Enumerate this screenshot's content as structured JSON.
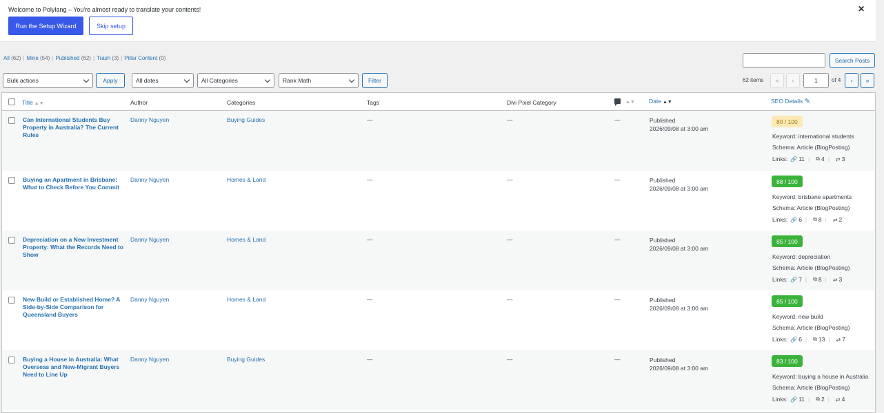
{
  "notice": {
    "message": "Welcome to Polylang – You're almost ready to translate your contents!",
    "wizard_label": "Run the Setup Wizard",
    "skip_label": "Skip setup",
    "close": "✕"
  },
  "views": [
    {
      "label": "All",
      "count": "(62)"
    },
    {
      "label": "Mine",
      "count": "(54)"
    },
    {
      "label": "Published",
      "count": "(62)"
    },
    {
      "label": "Trash",
      "count": "(3)"
    },
    {
      "label": "Pillar Content",
      "count": "(0)"
    }
  ],
  "search": {
    "button": "Search Posts",
    "value": ""
  },
  "filters": {
    "bulk": "Bulk actions",
    "apply": "Apply",
    "dates": "All dates",
    "categories": "All Categories",
    "rankmath": "Rank Math",
    "filter": "Filter"
  },
  "pagination": {
    "items": "62 items",
    "first": "«",
    "prev": "‹",
    "current": "1",
    "of": "of 4",
    "next": "›",
    "last": "»"
  },
  "columns": {
    "title": "Title",
    "author": "Author",
    "categories": "Categories",
    "tags": "Tags",
    "divi": "Divi Pixel Category",
    "date": "Date",
    "seo": "SEO Details"
  },
  "icons": {
    "link": "🔗",
    "external": "⧉",
    "incoming": "⇄",
    "pencil": "✎"
  },
  "posts": [
    {
      "title": "Can International Students Buy Property in Australia? The Current Rules",
      "author": "Danny Nguyen",
      "category": "Buying Guides",
      "tags": "—",
      "divi": "—",
      "comments": "—",
      "status": "Published",
      "date": "2026/09/08 at 3:00 am",
      "score": "80 / 100",
      "score_level": "ok",
      "keyword": "Keyword: international students",
      "schema": "Schema: Article (BlogPosting)",
      "links_label": "Links:",
      "internal": "11",
      "external": "4",
      "incoming": "3"
    },
    {
      "title": "Buying an Apartment in Brisbane: What to Check Before You Commit",
      "author": "Danny Nguyen",
      "category": "Homes & Land",
      "tags": "—",
      "divi": "—",
      "comments": "—",
      "status": "Published",
      "date": "2026/09/08 at 3:00 am",
      "score": "88 / 100",
      "score_level": "good",
      "keyword": "Keyword: brisbane apartments",
      "schema": "Schema: Article (BlogPosting)",
      "links_label": "Links:",
      "internal": "6",
      "external": "8",
      "incoming": "2"
    },
    {
      "title": "Depreciation on a New Investment Property: What the Records Need to Show",
      "author": "Danny Nguyen",
      "category": "Homes & Land",
      "tags": "—",
      "divi": "—",
      "comments": "—",
      "status": "Published",
      "date": "2026/09/08 at 3:00 am",
      "score": "85 / 100",
      "score_level": "good",
      "keyword": "Keyword: depreciation",
      "schema": "Schema: Article (BlogPosting)",
      "links_label": "Links:",
      "internal": "7",
      "external": "8",
      "incoming": "3"
    },
    {
      "title": "New Build or Established Home? A Side-by-Side Comparison for Queensland Buyers",
      "author": "Danny Nguyen",
      "category": "Homes & Land",
      "tags": "—",
      "divi": "—",
      "comments": "—",
      "status": "Published",
      "date": "2026/09/08 at 3:00 am",
      "score": "85 / 100",
      "score_level": "good",
      "keyword": "Keyword: new build",
      "schema": "Schema: Article (BlogPosting)",
      "links_label": "Links:",
      "internal": "6",
      "external": "13",
      "incoming": "7"
    },
    {
      "title": "Buying a House in Australia: What Overseas and New-Migrant Buyers Need to Line Up",
      "author": "Danny Nguyen",
      "category": "Buying Guides",
      "tags": "—",
      "divi": "—",
      "comments": "—",
      "status": "Published",
      "date": "2026/09/08 at 3:00 am",
      "score": "83 / 100",
      "score_level": "good",
      "keyword": "Keyword: buying a house in Australia",
      "schema": "Schema: Article (BlogPosting)",
      "links_label": "Links:",
      "internal": "11",
      "external": "2",
      "incoming": "4"
    }
  ]
}
